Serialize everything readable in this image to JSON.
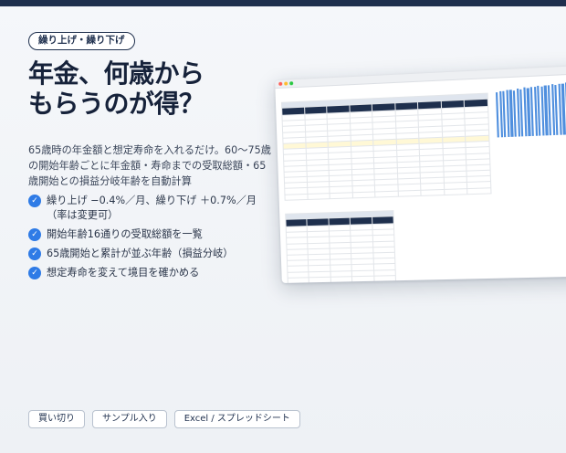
{
  "tag": "繰り上げ・繰り下げ",
  "title_lines": [
    "年金、何歳から",
    "もらうのが得？"
  ],
  "description": "65歳時の年金額と想定寿命を入れるだけ。60〜75歳の開始年齢ごとに年金額・寿命までの受取総額・65歳開始との損益分岐年齢を自動計算",
  "bullets": [
    {
      "icon": "check-icon",
      "text": "繰り上げ −0.4%／月、繰り下げ ＋0.7%／月（率は変更可）"
    },
    {
      "icon": "check-icon",
      "text": "開始年齢16通りの受取総額を一覧"
    },
    {
      "icon": "check-icon",
      "text": "65歳開始と累計が並ぶ年齢（損益分岐）"
    },
    {
      "icon": "check-icon",
      "text": "想定寿命を変えて境目を確かめる"
    }
  ],
  "chips": [
    "買い切り",
    "サンプル入り",
    "Excel / スプレッドシート"
  ],
  "colors": {
    "accent": "#2f7be6",
    "navy": "#1e2f4d"
  },
  "bar_levels": [
    0.86,
    0.88,
    0.87,
    0.89,
    0.9,
    0.88,
    0.91,
    0.9,
    0.92,
    0.91,
    0.93,
    0.92,
    0.94,
    0.93,
    0.95,
    0.94,
    0.96,
    0.95,
    0.97,
    0.96,
    0.98,
    0.97,
    0.99,
    0.98,
    1.0,
    0.99
  ]
}
